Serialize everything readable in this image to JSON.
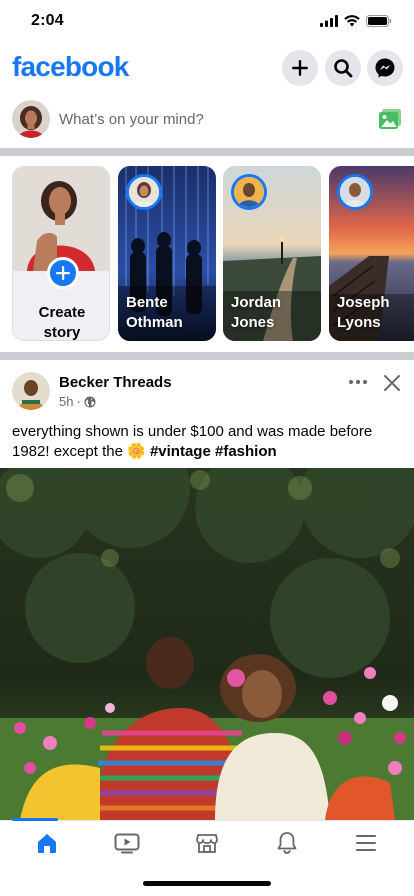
{
  "status_bar": {
    "time": "2:04"
  },
  "header": {
    "logo": "facebook",
    "brand_color": "#1877f2",
    "icons": [
      "plus-icon",
      "search-icon",
      "messenger-icon"
    ]
  },
  "composer": {
    "placeholder": "What’s on your mind?",
    "photo_icon": "photo-icon"
  },
  "stories": {
    "create": {
      "line1": "Create",
      "line2": "story"
    },
    "items": [
      {
        "first": "Bente",
        "last": "Othman"
      },
      {
        "first": "Jordan",
        "last": "Jones"
      },
      {
        "first": "Joseph",
        "last": "Lyons"
      }
    ]
  },
  "post": {
    "author": "Becker Threads",
    "time": "5h",
    "visibility_icon": "globe-icon",
    "text_before": "everything shown is under $100 and was made before 1982! except the",
    "emoji": "🌼",
    "tags": "#vintage #fashion"
  },
  "tabbar": {
    "active": "home",
    "tabs": [
      "home-icon",
      "video-icon",
      "marketplace-icon",
      "notifications-icon",
      "menu-icon"
    ]
  }
}
